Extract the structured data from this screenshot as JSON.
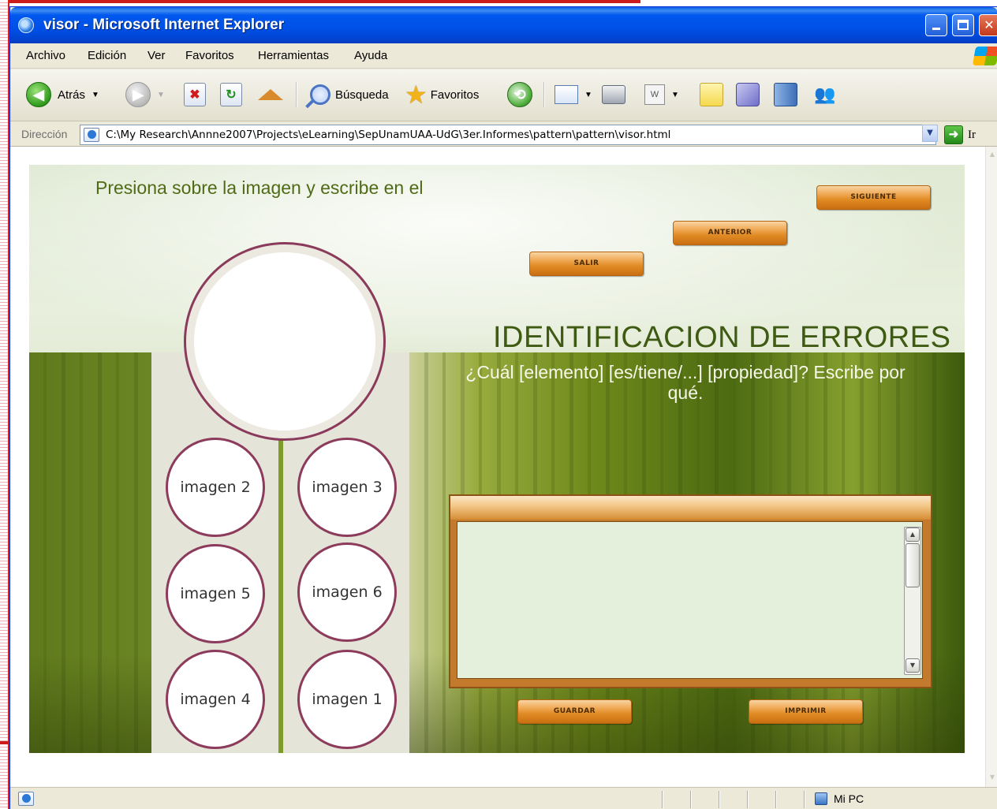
{
  "window": {
    "title": "visor - Microsoft Internet Explorer"
  },
  "menu": [
    "Archivo",
    "Edición",
    "Ver",
    "Favoritos",
    "Herramientas",
    "Ayuda"
  ],
  "toolbar": {
    "back_label": "Atrás",
    "search_label": "Búsqueda",
    "favorites_label": "Favoritos"
  },
  "address": {
    "label": "Dirección",
    "url": "C:\\My Research\\Annne2007\\Projects\\eLearning\\SepUnamUAA-UdG\\3er.Informes\\pattern\\pattern\\visor.html",
    "go_label": "Ir"
  },
  "content": {
    "instructions": "Presiona sobre la imagen y escribe en el",
    "title": "IDENTIFICACION DE ERRORES",
    "question": "¿Cuál [elemento] [es/tiene/...] [propiedad]? Escribe por qué.",
    "buttons": {
      "next": "SIGUIENTE",
      "previous": "ANTERIOR",
      "exit": "SALIR",
      "save": "GUARDAR",
      "print": "IMPRIMIR"
    },
    "thumbnails": [
      "imagen 2",
      "imagen 3",
      "imagen 5",
      "imagen 6",
      "imagen 4",
      "imagen 1"
    ],
    "notes_text": ""
  },
  "status": {
    "zone": "Mi PC"
  },
  "colors": {
    "titlebar": "#0054e3",
    "button_orange": "#e08a24",
    "circle_border": "#8d3b5c",
    "title_green": "#3f5a12"
  }
}
